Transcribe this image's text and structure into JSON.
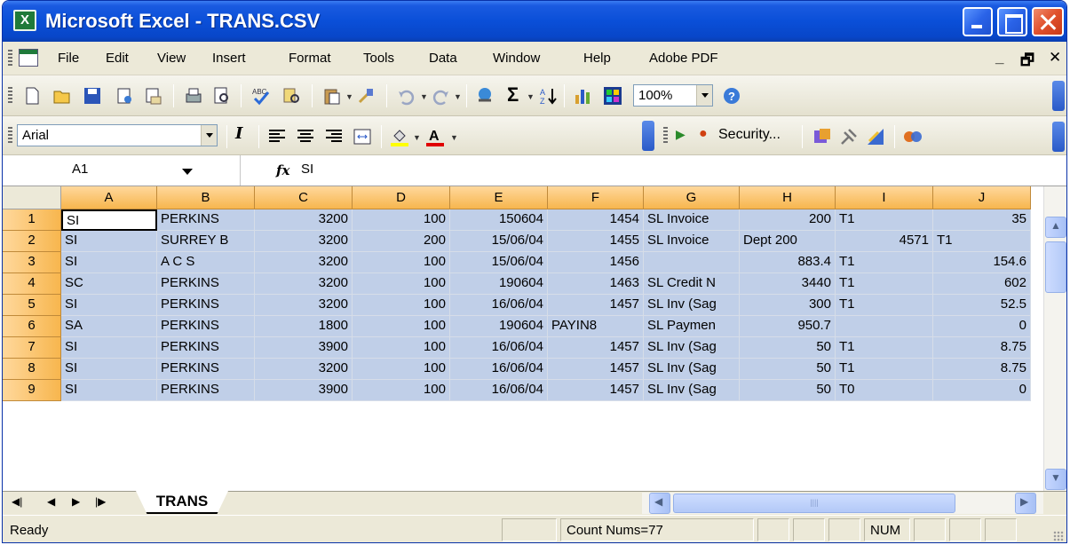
{
  "window": {
    "title": "Microsoft Excel - TRANS.CSV"
  },
  "menu": [
    "File",
    "Edit",
    "View",
    "Insert",
    "Format",
    "Tools",
    "Data",
    "Window",
    "Help",
    "Adobe PDF"
  ],
  "standard_toolbar": {
    "zoom": "100%"
  },
  "formatting_toolbar": {
    "font": "Arial",
    "security_label": "Security..."
  },
  "formula_bar": {
    "name_box": "A1",
    "fx_label": "fx",
    "formula": "SI"
  },
  "sheet": {
    "columns": [
      "A",
      "B",
      "C",
      "D",
      "E",
      "F",
      "G",
      "H",
      "I",
      "J"
    ],
    "rows": [
      {
        "n": "1",
        "cells": [
          "SI",
          "PERKINS",
          "3200",
          "100",
          "150604",
          "1454",
          "SL Invoice",
          "200",
          "T1",
          "35"
        ]
      },
      {
        "n": "2",
        "cells": [
          "SI",
          "SURREY B",
          "3200",
          "200",
          "15/06/04",
          "1455",
          "SL Invoice",
          "Dept 200",
          "4571",
          "T1"
        ]
      },
      {
        "n": "3",
        "cells": [
          "SI",
          "A C S",
          "3200",
          "100",
          "15/06/04",
          "1456",
          "",
          "883.4",
          "T1",
          "154.6"
        ]
      },
      {
        "n": "4",
        "cells": [
          "SC",
          "PERKINS",
          "3200",
          "100",
          "190604",
          "1463",
          "SL Credit N",
          "3440",
          "T1",
          "602"
        ]
      },
      {
        "n": "5",
        "cells": [
          "SI",
          "PERKINS",
          "3200",
          "100",
          "16/06/04",
          "1457",
          "SL Inv (Sag",
          "300",
          "T1",
          "52.5"
        ]
      },
      {
        "n": "6",
        "cells": [
          "SA",
          "PERKINS",
          "1800",
          "100",
          "190604",
          "PAYIN8",
          "SL Paymen",
          "950.7",
          "",
          "0"
        ]
      },
      {
        "n": "7",
        "cells": [
          "SI",
          "PERKINS",
          "3900",
          "100",
          "16/06/04",
          "1457",
          "SL Inv (Sag",
          "50",
          "T1",
          "8.75"
        ]
      },
      {
        "n": "8",
        "cells": [
          "SI",
          "PERKINS",
          "3200",
          "100",
          "16/06/04",
          "1457",
          "SL Inv (Sag",
          "50",
          "T1",
          "8.75"
        ]
      },
      {
        "n": "9",
        "cells": [
          "SI",
          "PERKINS",
          "3900",
          "100",
          "16/06/04",
          "1457",
          "SL Inv (Sag",
          "50",
          "T0",
          "0"
        ]
      }
    ]
  },
  "tabs": {
    "active": "TRANS"
  },
  "status": {
    "text": "Ready",
    "count": "Count Nums=77",
    "num": "NUM"
  }
}
